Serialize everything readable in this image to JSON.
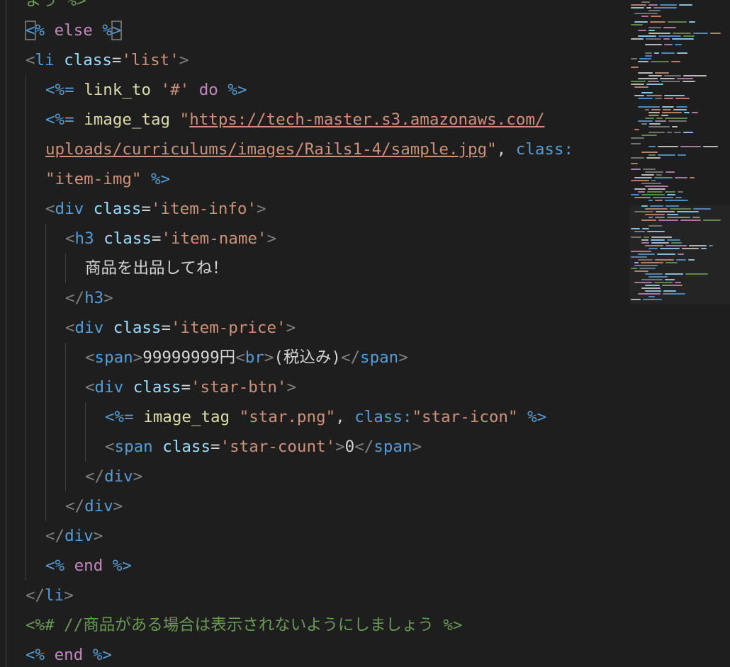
{
  "editor": {
    "language": "erb",
    "lines": [
      [
        {
          "c": "t-cm",
          "t": "よう %>"
        }
      ],
      [
        {
          "c": "t-delim cursor-bracket",
          "t": "<"
        },
        {
          "c": "t-delim",
          "t": "%"
        },
        {
          "c": "t-text",
          "t": " "
        },
        {
          "c": "t-kw",
          "t": "else"
        },
        {
          "c": "t-text",
          "t": " "
        },
        {
          "c": "t-delim",
          "t": "%"
        },
        {
          "c": "t-delim cursor-bracket",
          "t": ">"
        }
      ],
      [
        {
          "c": "t-tag",
          "t": "<"
        },
        {
          "c": "t-tn",
          "t": "li"
        },
        {
          "c": "t-text",
          "t": " "
        },
        {
          "c": "t-attr",
          "t": "class"
        },
        {
          "c": "t-text",
          "t": "="
        },
        {
          "c": "t-str",
          "t": "'list'"
        },
        {
          "c": "t-tag",
          "t": ">"
        }
      ],
      [
        {
          "c": "t-delim",
          "t": "<%="
        },
        {
          "c": "t-text",
          "t": " "
        },
        {
          "c": "t-ruby",
          "t": "link_to"
        },
        {
          "c": "t-text",
          "t": " "
        },
        {
          "c": "t-str",
          "t": "'#'"
        },
        {
          "c": "t-text",
          "t": " "
        },
        {
          "c": "t-kw",
          "t": "do"
        },
        {
          "c": "t-text",
          "t": " "
        },
        {
          "c": "t-delim",
          "t": "%>"
        }
      ],
      [
        {
          "c": "t-delim",
          "t": "<%="
        },
        {
          "c": "t-text",
          "t": " "
        },
        {
          "c": "t-ruby",
          "t": "image_tag"
        },
        {
          "c": "t-text",
          "t": " "
        },
        {
          "c": "t-str",
          "t": "\""
        },
        {
          "c": "t-url",
          "t": "https://tech-master.s3.amazonaws.com/"
        }
      ],
      [
        {
          "c": "t-url",
          "t": "uploads/curriculums/images/Rails1-4/sample.jpg"
        },
        {
          "c": "t-str",
          "t": "\""
        },
        {
          "c": "t-text",
          "t": ", "
        },
        {
          "c": "t-tn",
          "t": "class:"
        }
      ],
      [
        {
          "c": "t-str",
          "t": "\"item-img\""
        },
        {
          "c": "t-text",
          "t": " "
        },
        {
          "c": "t-delim",
          "t": "%>"
        }
      ],
      [
        {
          "c": "t-tag",
          "t": "<"
        },
        {
          "c": "t-tn",
          "t": "div"
        },
        {
          "c": "t-text",
          "t": " "
        },
        {
          "c": "t-attr",
          "t": "class"
        },
        {
          "c": "t-text",
          "t": "="
        },
        {
          "c": "t-str",
          "t": "'item-info'"
        },
        {
          "c": "t-tag",
          "t": ">"
        }
      ],
      [
        {
          "c": "t-tag",
          "t": "<"
        },
        {
          "c": "t-tn",
          "t": "h3"
        },
        {
          "c": "t-text",
          "t": " "
        },
        {
          "c": "t-attr",
          "t": "class"
        },
        {
          "c": "t-text",
          "t": "="
        },
        {
          "c": "t-str",
          "t": "'item-name'"
        },
        {
          "c": "t-tag",
          "t": ">"
        }
      ],
      [
        {
          "c": "t-text",
          "t": "商品を出品してね！"
        }
      ],
      [
        {
          "c": "t-tag",
          "t": "</"
        },
        {
          "c": "t-tn",
          "t": "h3"
        },
        {
          "c": "t-tag",
          "t": ">"
        }
      ],
      [
        {
          "c": "t-tag",
          "t": "<"
        },
        {
          "c": "t-tn",
          "t": "div"
        },
        {
          "c": "t-text",
          "t": " "
        },
        {
          "c": "t-attr",
          "t": "class"
        },
        {
          "c": "t-text",
          "t": "="
        },
        {
          "c": "t-str",
          "t": "'item-price'"
        },
        {
          "c": "t-tag",
          "t": ">"
        }
      ],
      [
        {
          "c": "t-tag",
          "t": "<"
        },
        {
          "c": "t-tn",
          "t": "span"
        },
        {
          "c": "t-tag",
          "t": ">"
        },
        {
          "c": "t-text",
          "t": "99999999円"
        },
        {
          "c": "t-tag",
          "t": "<"
        },
        {
          "c": "t-tn",
          "t": "br"
        },
        {
          "c": "t-tag",
          "t": ">"
        },
        {
          "c": "t-text",
          "t": "(税込み)"
        },
        {
          "c": "t-tag",
          "t": "</"
        },
        {
          "c": "t-tn",
          "t": "span"
        },
        {
          "c": "t-tag",
          "t": ">"
        }
      ],
      [
        {
          "c": "t-tag",
          "t": "<"
        },
        {
          "c": "t-tn",
          "t": "div"
        },
        {
          "c": "t-text",
          "t": " "
        },
        {
          "c": "t-attr",
          "t": "class"
        },
        {
          "c": "t-text",
          "t": "="
        },
        {
          "c": "t-str",
          "t": "'star-btn'"
        },
        {
          "c": "t-tag",
          "t": ">"
        }
      ],
      [
        {
          "c": "t-delim",
          "t": "<%="
        },
        {
          "c": "t-text",
          "t": " "
        },
        {
          "c": "t-ruby",
          "t": "image_tag"
        },
        {
          "c": "t-text",
          "t": " "
        },
        {
          "c": "t-str",
          "t": "\"star.png\""
        },
        {
          "c": "t-text",
          "t": ", "
        },
        {
          "c": "t-tn",
          "t": "class:"
        },
        {
          "c": "t-str",
          "t": "\"star-icon\""
        },
        {
          "c": "t-text",
          "t": " "
        },
        {
          "c": "t-delim",
          "t": "%>"
        }
      ],
      [
        {
          "c": "t-tag",
          "t": "<"
        },
        {
          "c": "t-tn",
          "t": "span"
        },
        {
          "c": "t-text",
          "t": " "
        },
        {
          "c": "t-attr",
          "t": "class"
        },
        {
          "c": "t-text",
          "t": "="
        },
        {
          "c": "t-str",
          "t": "'star-count'"
        },
        {
          "c": "t-tag",
          "t": ">"
        },
        {
          "c": "t-text",
          "t": "0"
        },
        {
          "c": "t-tag",
          "t": "</"
        },
        {
          "c": "t-tn",
          "t": "span"
        },
        {
          "c": "t-tag",
          "t": ">"
        }
      ],
      [
        {
          "c": "t-tag",
          "t": "</"
        },
        {
          "c": "t-tn",
          "t": "div"
        },
        {
          "c": "t-tag",
          "t": ">"
        }
      ],
      [
        {
          "c": "t-tag",
          "t": "</"
        },
        {
          "c": "t-tn",
          "t": "div"
        },
        {
          "c": "t-tag",
          "t": ">"
        }
      ],
      [
        {
          "c": "t-tag",
          "t": "</"
        },
        {
          "c": "t-tn",
          "t": "div"
        },
        {
          "c": "t-tag",
          "t": ">"
        }
      ],
      [
        {
          "c": "t-delim",
          "t": "<%"
        },
        {
          "c": "t-text",
          "t": " "
        },
        {
          "c": "t-kw",
          "t": "end"
        },
        {
          "c": "t-text",
          "t": " "
        },
        {
          "c": "t-delim",
          "t": "%>"
        }
      ],
      [
        {
          "c": "t-tag",
          "t": "</"
        },
        {
          "c": "t-tn",
          "t": "li"
        },
        {
          "c": "t-tag",
          "t": ">"
        }
      ],
      [
        {
          "c": "t-cm",
          "t": "<%# //商品がある場合は表示されないようにしましょう %>"
        }
      ],
      [
        {
          "c": "t-delim",
          "t": "<%"
        },
        {
          "c": "t-text",
          "t": " "
        },
        {
          "c": "t-kw",
          "t": "end"
        },
        {
          "c": "t-text",
          "t": " "
        },
        {
          "c": "t-delim",
          "t": "%>"
        }
      ]
    ]
  },
  "colors": {
    "background": "#1e1e1e",
    "erb_delimiter": "#569cd6",
    "keyword": "#c586c0",
    "tag_bracket": "#808080",
    "tag_name": "#569cd6",
    "attribute": "#9cdcfe",
    "string": "#ce9178",
    "method": "#dcdcaa",
    "comment": "#6a9955"
  }
}
